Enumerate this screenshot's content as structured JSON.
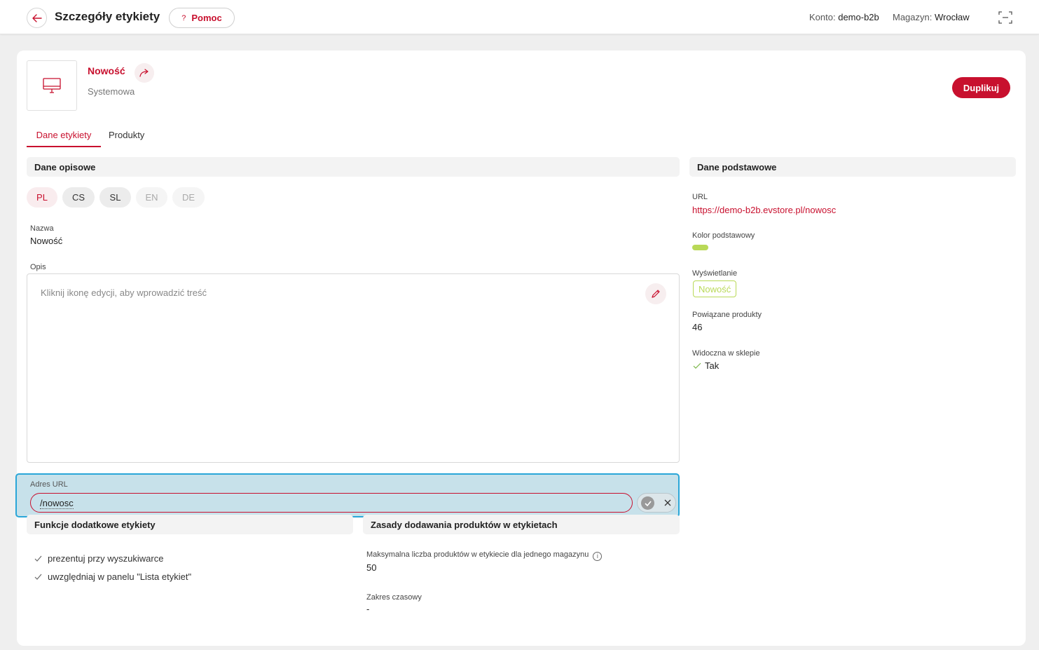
{
  "header": {
    "title": "Szczegóły etykiety",
    "help_label": "Pomoc",
    "help_icon": "?",
    "account_label": "Konto:",
    "account_value": "demo-b2b",
    "warehouse_label": "Magazyn:",
    "warehouse_value": "Wrocław"
  },
  "label": {
    "name": "Nowość",
    "type": "Systemowa",
    "duplicate_label": "Duplikuj"
  },
  "tabs": [
    {
      "label": "Dane etykiety",
      "active": true
    },
    {
      "label": "Produkty",
      "active": false
    }
  ],
  "descriptive": {
    "section_title": "Dane opisowe",
    "languages": [
      {
        "code": "PL",
        "state": "active"
      },
      {
        "code": "CS",
        "state": "filled"
      },
      {
        "code": "SL",
        "state": "filled"
      },
      {
        "code": "EN",
        "state": "empty"
      },
      {
        "code": "DE",
        "state": "empty"
      }
    ],
    "name_label": "Nazwa",
    "name_value": "Nowość",
    "desc_label": "Opis",
    "desc_placeholder": "Kliknij ikonę edycji, aby wprowadzić treść",
    "url_label": "Adres URL",
    "url_value": "/nowosc"
  },
  "extra_functions": {
    "section_title": "Funkcje dodatkowe etykiety",
    "items": [
      "prezentuj przy wyszukiwarce",
      "uwzględniaj w panelu \"Lista etykiet\""
    ]
  },
  "rules": {
    "section_title": "Zasady dodawania produktów w etykietach",
    "max_label": "Maksymalna liczba produktów w etykiecie dla jednego magazynu",
    "max_value": "50",
    "range_label": "Zakres czasowy",
    "range_value": "-"
  },
  "basic": {
    "section_title": "Dane podstawowe",
    "url_label": "URL",
    "url_value": "https://demo-b2b.evstore.pl/nowosc",
    "color_label": "Kolor podstawowy",
    "color_value": "#b9d957",
    "display_label": "Wyświetlanie",
    "display_value": "Nowość",
    "products_label": "Powiązane produkty",
    "products_value": "46",
    "visible_label": "Widoczna w sklepie",
    "visible_value": "Tak"
  },
  "colors": {
    "accent": "#c8102e",
    "highlight": "#c7e1ea",
    "highlight_border": "#2aa6d8",
    "label_color": "#b9d957"
  }
}
